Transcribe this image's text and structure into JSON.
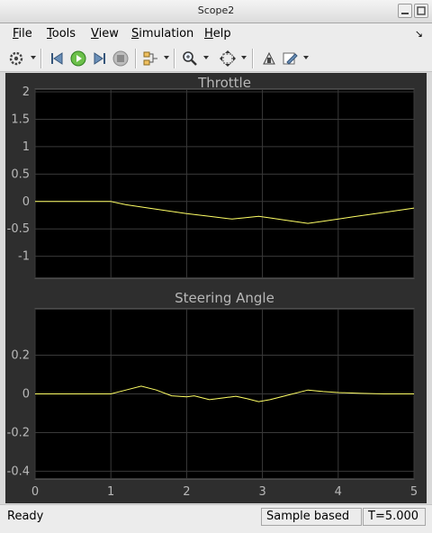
{
  "window": {
    "title": "Scope2"
  },
  "menu": {
    "items": [
      {
        "underline": "F",
        "rest": "ile"
      },
      {
        "underline": "T",
        "rest": "ools"
      },
      {
        "underline": "V",
        "rest": "iew"
      },
      {
        "underline": "S",
        "rest": "imulation"
      },
      {
        "underline": "H",
        "rest": "elp"
      }
    ]
  },
  "toolbar": {
    "icons": [
      "gear-icon",
      "step-back-icon",
      "run-icon",
      "step-forward-icon",
      "stop-icon",
      "signal-select-icon",
      "zoom-icon",
      "autoscale-icon",
      "highlight-icon",
      "edit-icon"
    ]
  },
  "status": {
    "ready": "Ready",
    "mode": "Sample based",
    "time": "T=5.000"
  },
  "colors": {
    "trace": "#ffff66",
    "grid": "#3a3a3a",
    "axes_bg": "#000000",
    "figure_bg": "#2e2e2e"
  },
  "chart_data": [
    {
      "type": "line",
      "title": "Throttle",
      "xlim": [
        0,
        5
      ],
      "ylim": [
        -1.4,
        2.05
      ],
      "xticks": [
        0,
        1,
        2,
        3,
        4,
        5
      ],
      "yticks": [
        2,
        1.5,
        1,
        0.5,
        0,
        -0.5,
        -1
      ],
      "ytick_labels": [
        "2",
        "1.5",
        "1",
        "0.5",
        "0",
        "-0.5",
        "-1"
      ],
      "grid": true,
      "series": [
        {
          "x": [
            0,
            1.0,
            1.2,
            1.5,
            2.0,
            2.3,
            2.6,
            2.75,
            2.95,
            3.1,
            3.3,
            3.6,
            3.8,
            4.2,
            4.6,
            5.0
          ],
          "y": [
            0,
            0,
            -0.06,
            -0.12,
            -0.22,
            -0.27,
            -0.32,
            -0.3,
            -0.27,
            -0.3,
            -0.34,
            -0.4,
            -0.36,
            -0.28,
            -0.2,
            -0.12
          ]
        }
      ]
    },
    {
      "type": "line",
      "title": "Steering Angle",
      "xlim": [
        0,
        5
      ],
      "ylim": [
        -0.44,
        0.44
      ],
      "xticks": [
        0,
        1,
        2,
        3,
        4,
        5
      ],
      "xtick_labels": [
        "0",
        "1",
        "2",
        "3",
        "4",
        "5"
      ],
      "yticks": [
        0.2,
        0,
        -0.2,
        -0.4
      ],
      "ytick_labels": [
        "0.2",
        "0",
        "-0.2",
        "-0.4"
      ],
      "grid": true,
      "series": [
        {
          "x": [
            0,
            1.0,
            1.2,
            1.4,
            1.6,
            1.8,
            2.0,
            2.1,
            2.3,
            2.5,
            2.65,
            2.8,
            2.95,
            3.1,
            3.3,
            3.6,
            3.8,
            4.0,
            4.3,
            4.6,
            5.0
          ],
          "y": [
            0,
            0,
            0.02,
            0.04,
            0.02,
            -0.01,
            -0.015,
            -0.01,
            -0.03,
            -0.02,
            -0.012,
            -0.025,
            -0.04,
            -0.03,
            -0.01,
            0.02,
            0.012,
            0.007,
            0.003,
            0.0,
            0.0
          ]
        }
      ]
    }
  ]
}
